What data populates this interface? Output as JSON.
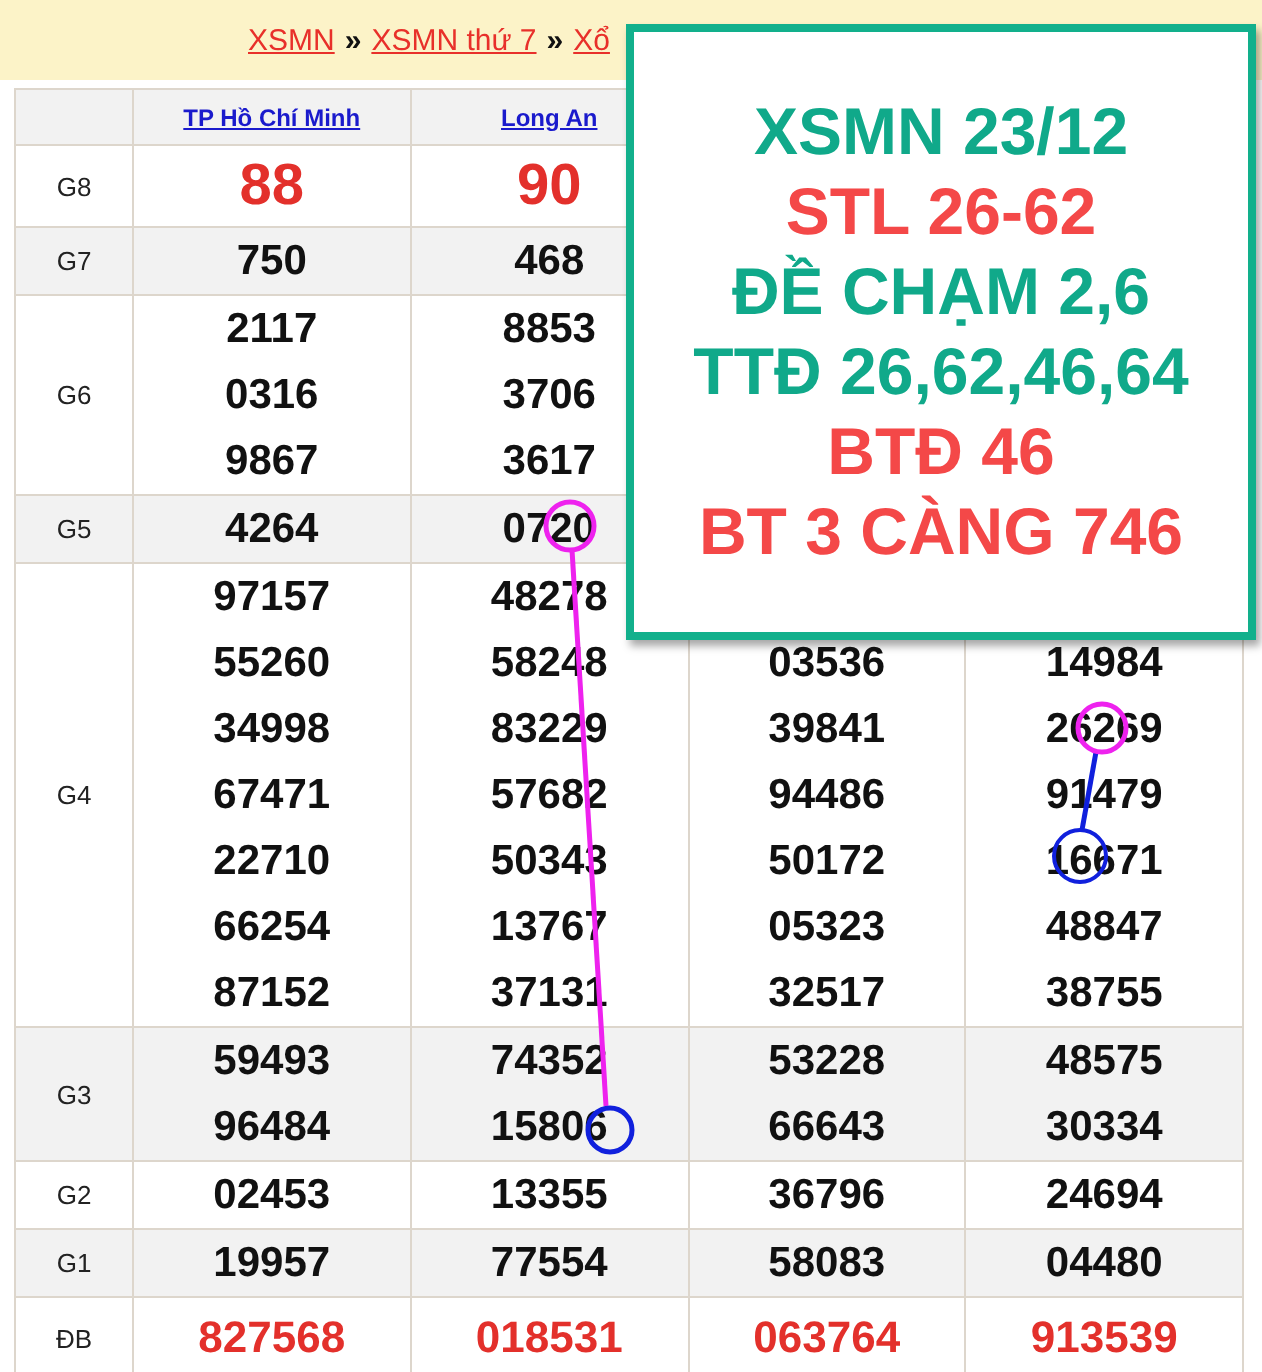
{
  "breadcrumb": [
    {
      "kind": "link",
      "text": "XSMN"
    },
    {
      "kind": "separator",
      "text": "»"
    },
    {
      "kind": "link",
      "text": "XSMN thứ 7"
    },
    {
      "kind": "separator",
      "text": "»"
    },
    {
      "kind": "link",
      "text": "Xổ"
    }
  ],
  "table": {
    "columns": [
      "TP Hồ Chí Minh",
      "Long An"
    ],
    "rows": [
      {
        "prize": "G8",
        "kind": "big",
        "cells": [
          [
            "88"
          ],
          [
            "90"
          ]
        ]
      },
      {
        "prize": "G7",
        "kind": "normal",
        "cells": [
          [
            "750"
          ],
          [
            "468"
          ]
        ]
      },
      {
        "prize": "G6",
        "kind": "normal",
        "cells": [
          [
            "2117",
            "0316",
            "9867"
          ],
          [
            "8853",
            "3706",
            "3617"
          ]
        ]
      },
      {
        "prize": "G5",
        "kind": "normal",
        "cells": [
          [
            "4264"
          ],
          [
            "0720"
          ]
        ]
      },
      {
        "prize": "G4",
        "kind": "normal",
        "cells": [
          [
            "97157",
            "55260",
            "34998",
            "67471",
            "22710",
            "66254",
            "87152"
          ],
          [
            "48278",
            "58248",
            "83229",
            "57682",
            "50343",
            "13767",
            "37131"
          ],
          [
            "03536",
            "39841",
            "94486",
            "50172",
            "05323",
            "32517"
          ],
          [
            "14984",
            "26269",
            "91479",
            "16671",
            "48847",
            "38755"
          ]
        ]
      },
      {
        "prize": "G3",
        "kind": "normal",
        "cells": [
          [
            "59493",
            "96484"
          ],
          [
            "74352",
            "15806"
          ],
          [
            "53228",
            "66643"
          ],
          [
            "48575",
            "30334"
          ]
        ]
      },
      {
        "prize": "G2",
        "kind": "normal",
        "cells": [
          [
            "02453"
          ],
          [
            "13355"
          ],
          [
            "36796"
          ],
          [
            "24694"
          ]
        ]
      },
      {
        "prize": "G1",
        "kind": "normal",
        "cells": [
          [
            "19957"
          ],
          [
            "77554"
          ],
          [
            "58083"
          ],
          [
            "04480"
          ]
        ]
      },
      {
        "prize": "ĐB",
        "kind": "special",
        "cells": [
          [
            "827568"
          ],
          [
            "018531"
          ],
          [
            "063764"
          ],
          [
            "913539"
          ]
        ]
      }
    ]
  },
  "overlay": {
    "lines": [
      {
        "text": "XSMN 23/12",
        "color": "#10a98a"
      },
      {
        "text": "STL 26-62",
        "color": "#f44848"
      },
      {
        "text": "ĐỀ CHẠM 2,6",
        "color": "#10a98a"
      },
      {
        "text": "TTĐ 26,62,46,64",
        "color": "#10a98a"
      },
      {
        "text": "BTĐ 46",
        "color": "#f44848"
      },
      {
        "text": "BT 3 CÀNG 746",
        "color": "#f44848"
      }
    ]
  }
}
